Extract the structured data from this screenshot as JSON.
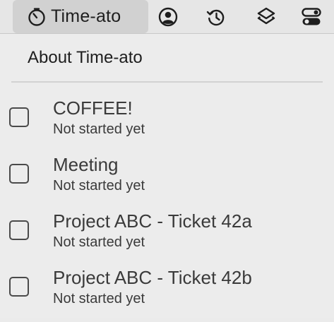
{
  "menubar": {
    "app_title": "Time-ato",
    "app_icon": "timer-icon",
    "tray_icons": [
      "account-icon",
      "history-icon",
      "layers-icon",
      "toggles-icon"
    ]
  },
  "menu": {
    "about_label": "About Time-ato",
    "tasks": [
      {
        "name": "COFFEE!",
        "status": "Not started yet",
        "checked": false
      },
      {
        "name": "Meeting",
        "status": "Not started yet",
        "checked": false
      },
      {
        "name": "Project ABC - Ticket 42a",
        "status": "Not started yet",
        "checked": false
      },
      {
        "name": "Project ABC - Ticket 42b",
        "status": "Not started yet",
        "checked": false
      }
    ]
  }
}
